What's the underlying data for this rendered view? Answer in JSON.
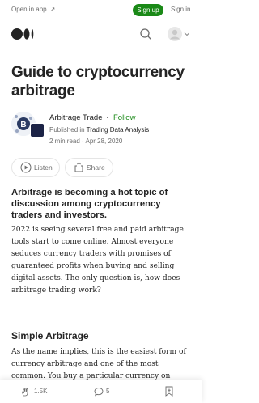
{
  "topbar": {
    "open_in_app": "Open in app",
    "sign_up": "Sign up",
    "sign_in": "Sign in"
  },
  "article": {
    "title": "Guide to cryptocurrency arbitrage",
    "author": "Arbitrage Trade",
    "separator": "·",
    "follow": "Follow",
    "published_prefix": "Published in",
    "publication": "Trading Data Analysis",
    "read_time": "2 min read",
    "meta_sep": "·",
    "date": "Apr 28, 2020",
    "listen": "Listen",
    "share": "Share",
    "subtitle": "Arbitrage is becoming a hot topic of discussion among cryptocurrency traders and investors.",
    "paragraph1": "2022 is seeing several free and paid arbitrage tools start to come online. Almost everyone seduces currency traders with promises of guaranteed profits when buying and selling digital assets. The only question is, how does arbitrage trading work?",
    "heading2": "Simple Arbitrage",
    "paragraph2": "As the name implies, this is the easiest form of currency arbitrage and one of the most common. You buy a particular currency on"
  },
  "bottombar": {
    "claps": "1.5K",
    "responses": "5"
  },
  "colors": {
    "accent": "#1a8917",
    "text": "#242424",
    "muted": "#6b6b6b"
  },
  "icons": [
    "external-arrow-icon",
    "medium-logo",
    "search-icon",
    "user-avatar-icon",
    "play-icon",
    "share-icon",
    "clap-icon",
    "response-icon",
    "bookmark-icon"
  ]
}
